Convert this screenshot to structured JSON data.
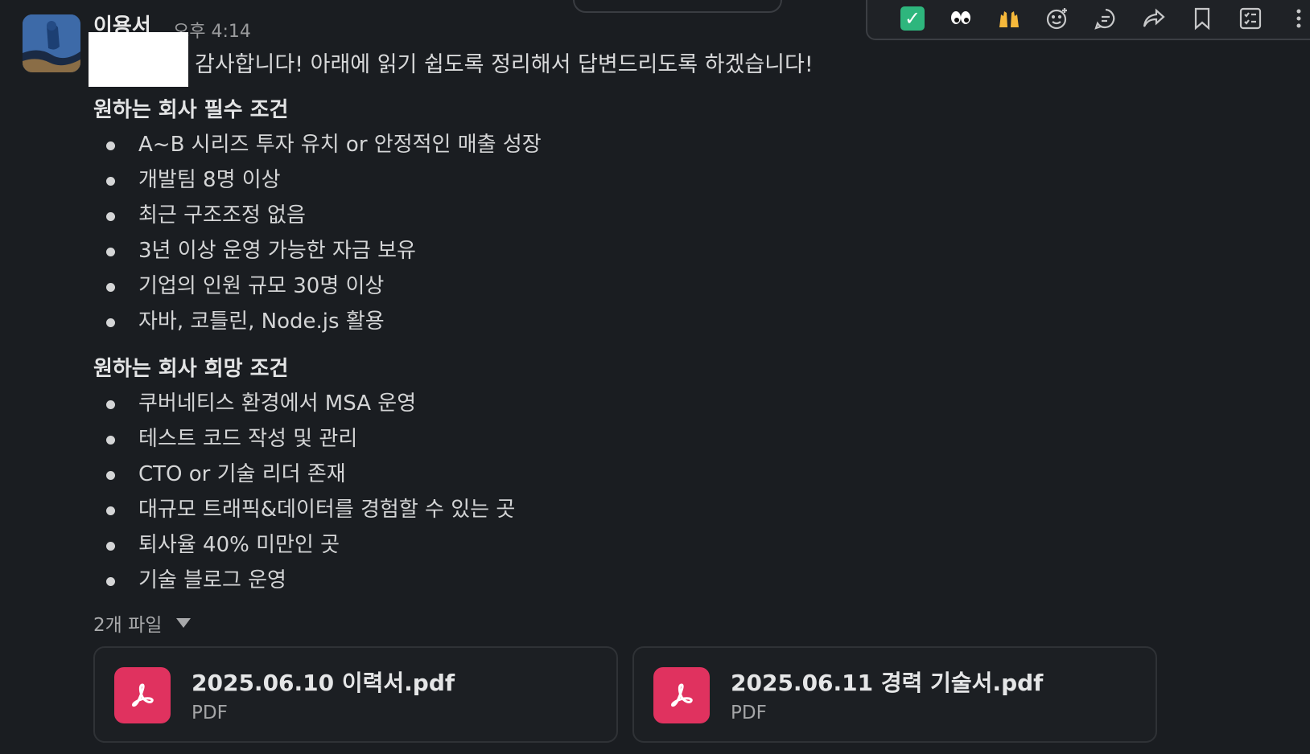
{
  "message": {
    "sender": "이용서",
    "timestamp": "오후 4:14",
    "intro": "감사합니다! 아래에 읽기 쉽도록 정리해서 답변드리도록 하겠습니다!"
  },
  "sections": [
    {
      "title": "원하는 회사 필수 조건",
      "items": [
        "A~B 시리즈 투자 유치 or 안정적인 매출 성장",
        "개발팀 8명 이상",
        "최근 구조조정 없음",
        "3년 이상 운영 가능한 자금 보유",
        "기업의 인원 규모 30명 이상",
        "자바, 코틀린, Node.js 활용"
      ]
    },
    {
      "title": "원하는 회사 희망 조건",
      "items": [
        "쿠버네티스 환경에서 MSA 운영",
        "테스트 코드 작성 및 관리",
        "CTO or 기술 리더 존재",
        "대규모 트래픽&데이터를 경험할 수 있는 곳",
        "퇴사율 40% 미만인 곳",
        "기술 블로그 운영"
      ]
    }
  ],
  "files": {
    "toggle_label": "2개 파일",
    "items": [
      {
        "name": "2025.06.10 이력서.pdf",
        "type": "PDF"
      },
      {
        "name": "2025.06.11 경력 기술서.pdf",
        "type": "PDF"
      }
    ]
  },
  "toolbar": {
    "reactions": [
      {
        "icon": "check-mark-emoji",
        "glyph": "✓"
      },
      {
        "icon": "eyes-emoji",
        "glyph": "👀"
      },
      {
        "icon": "raised-hands-emoji",
        "glyph": "🙌"
      }
    ],
    "actions": [
      "add-reaction-icon",
      "reply-thread-icon",
      "share-icon",
      "bookmark-icon",
      "checklist-icon",
      "more-icon"
    ]
  },
  "colors": {
    "background": "#1a1d21",
    "pdf_icon": "#e0325f",
    "check": "#2eb67d"
  }
}
